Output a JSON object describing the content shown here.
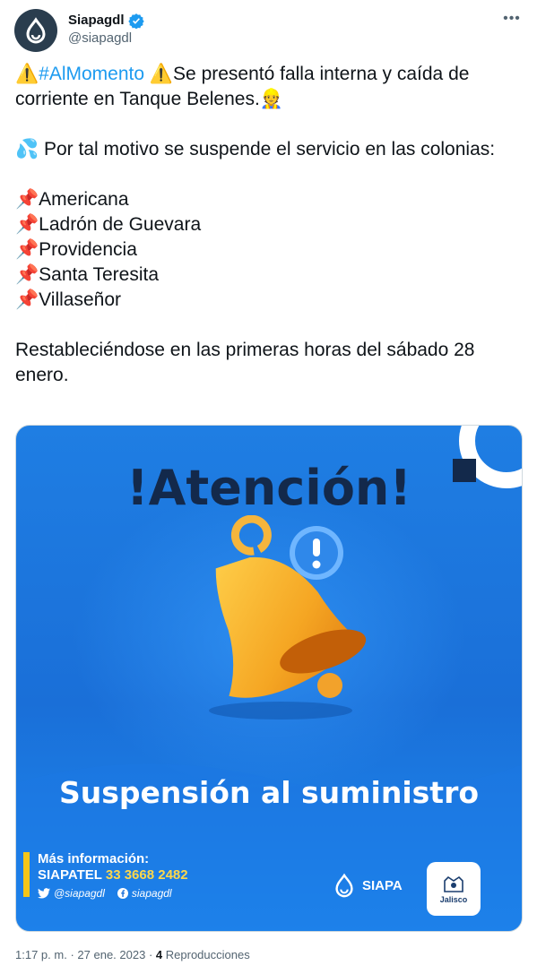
{
  "author": {
    "display_name": "Siapagdl",
    "handle": "@siapagdl",
    "avatar_icon": "water-drop-icon",
    "verified_icon": "verified-badge-icon",
    "more_icon": "more-options-icon"
  },
  "tweet": {
    "hashtag": "#AlMomento",
    "line1_rest": "Se presentó falla interna y caída de corriente en Tanque Belenes.",
    "warning_emoji": "⚠️",
    "worker_emoji": "👷",
    "water_emoji": "💦",
    "para2": "Por tal motivo se suspende el servicio en las colonias:",
    "pin_emoji": "📌",
    "colonias": [
      "Americana",
      "Ladrón de Guevara",
      "Providencia",
      "Santa Teresita",
      "Villaseñor"
    ],
    "closing": "Restableciéndose en las primeras horas del sábado 28 enero."
  },
  "media": {
    "headline": "!Atención!",
    "subheadline": "Suspensión al suministro",
    "info_title": "Más información:",
    "info_phone_label": "SIAPATEL",
    "info_phone_number": "33 3668 2482",
    "twitter_handle": "@siapagdl",
    "facebook_handle": "siapagdl",
    "brand": "SIAPA",
    "seal_text": "Jalisco",
    "colors": {
      "background": "#1a6fd8",
      "headline": "#13294b",
      "bell": "#f5a623",
      "accent": "#ffd84a"
    }
  },
  "meta": {
    "time": "1:17 p. m.",
    "separator": "·",
    "date": "27 ene. 2023",
    "views_count": "4",
    "views_label": "Reproducciones"
  }
}
